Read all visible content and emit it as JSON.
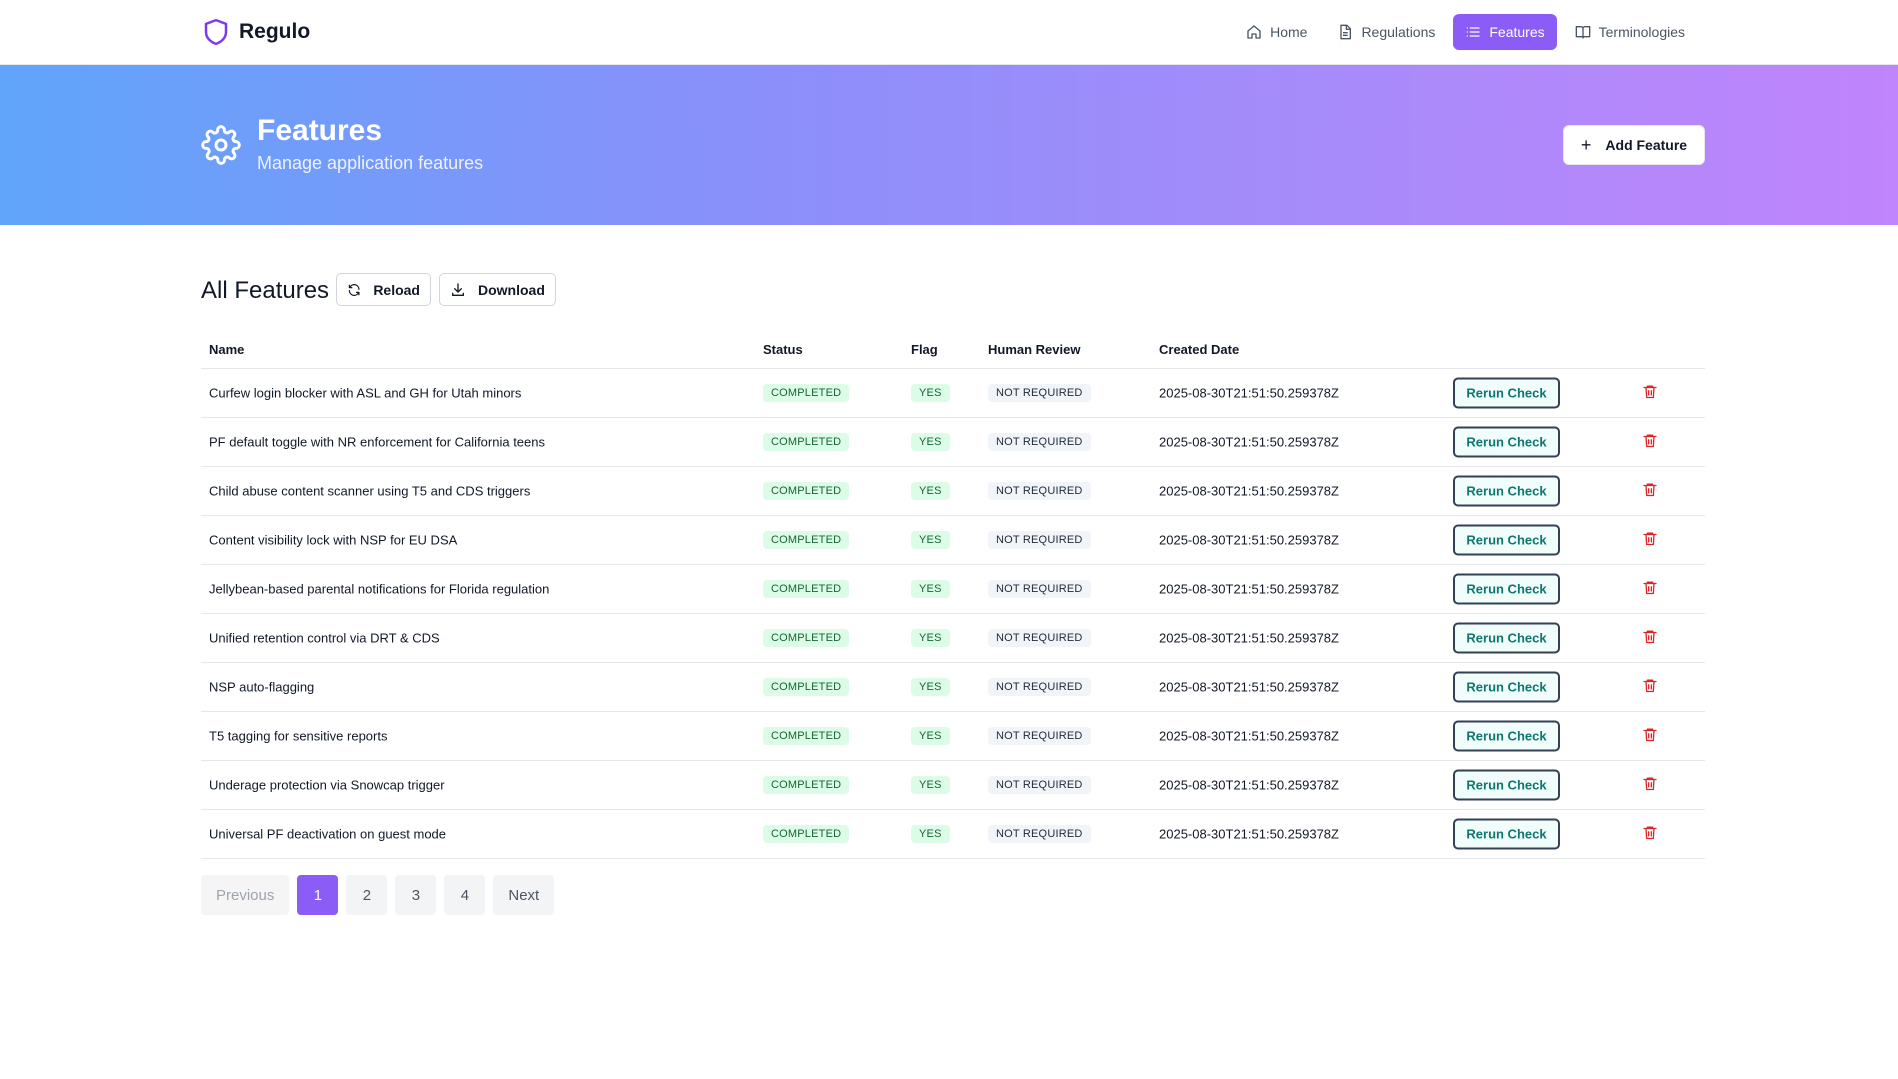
{
  "brand": {
    "name": "Regulo"
  },
  "nav": {
    "items": [
      {
        "label": "Home",
        "icon": "home-icon"
      },
      {
        "label": "Regulations",
        "icon": "document-icon"
      },
      {
        "label": "Features",
        "icon": "list-icon",
        "active": true
      },
      {
        "label": "Terminologies",
        "icon": "book-icon"
      }
    ]
  },
  "hero": {
    "title": "Features",
    "subtitle": "Manage application features",
    "add_label": "Add Feature"
  },
  "section": {
    "title": "All Features",
    "reload_label": "Reload",
    "download_label": "Download"
  },
  "table": {
    "headers": {
      "name": "Name",
      "status": "Status",
      "flag": "Flag",
      "review": "Human Review",
      "created": "Created Date"
    },
    "rerun_label": "Rerun Check",
    "rows": [
      {
        "name": "Curfew login blocker with ASL and GH for Utah minors",
        "status": "COMPLETED",
        "flag": "YES",
        "review": "NOT REQUIRED",
        "created": "2025-08-30T21:51:50.259378Z"
      },
      {
        "name": "PF default toggle with NR enforcement for California teens",
        "status": "COMPLETED",
        "flag": "YES",
        "review": "NOT REQUIRED",
        "created": "2025-08-30T21:51:50.259378Z"
      },
      {
        "name": "Child abuse content scanner using T5 and CDS triggers",
        "status": "COMPLETED",
        "flag": "YES",
        "review": "NOT REQUIRED",
        "created": "2025-08-30T21:51:50.259378Z"
      },
      {
        "name": "Content visibility lock with NSP for EU DSA",
        "status": "COMPLETED",
        "flag": "YES",
        "review": "NOT REQUIRED",
        "created": "2025-08-30T21:51:50.259378Z"
      },
      {
        "name": "Jellybean-based parental notifications for Florida regulation",
        "status": "COMPLETED",
        "flag": "YES",
        "review": "NOT REQUIRED",
        "created": "2025-08-30T21:51:50.259378Z"
      },
      {
        "name": "Unified retention control via DRT & CDS",
        "status": "COMPLETED",
        "flag": "YES",
        "review": "NOT REQUIRED",
        "created": "2025-08-30T21:51:50.259378Z"
      },
      {
        "name": "NSP auto-flagging",
        "status": "COMPLETED",
        "flag": "YES",
        "review": "NOT REQUIRED",
        "created": "2025-08-30T21:51:50.259378Z"
      },
      {
        "name": "T5 tagging for sensitive reports",
        "status": "COMPLETED",
        "flag": "YES",
        "review": "NOT REQUIRED",
        "created": "2025-08-30T21:51:50.259378Z"
      },
      {
        "name": "Underage protection via Snowcap trigger",
        "status": "COMPLETED",
        "flag": "YES",
        "review": "NOT REQUIRED",
        "created": "2025-08-30T21:51:50.259378Z"
      },
      {
        "name": "Universal PF deactivation on guest mode",
        "status": "COMPLETED",
        "flag": "YES",
        "review": "NOT REQUIRED",
        "created": "2025-08-30T21:51:50.259378Z"
      }
    ]
  },
  "pagination": {
    "previous": "Previous",
    "pages": [
      "1",
      "2",
      "3",
      "4"
    ],
    "current": "1",
    "next": "Next"
  },
  "colors": {
    "accent": "#8b5cf6",
    "danger": "#dc2626",
    "success_bg": "#dcfce7",
    "success_text": "#166534"
  }
}
